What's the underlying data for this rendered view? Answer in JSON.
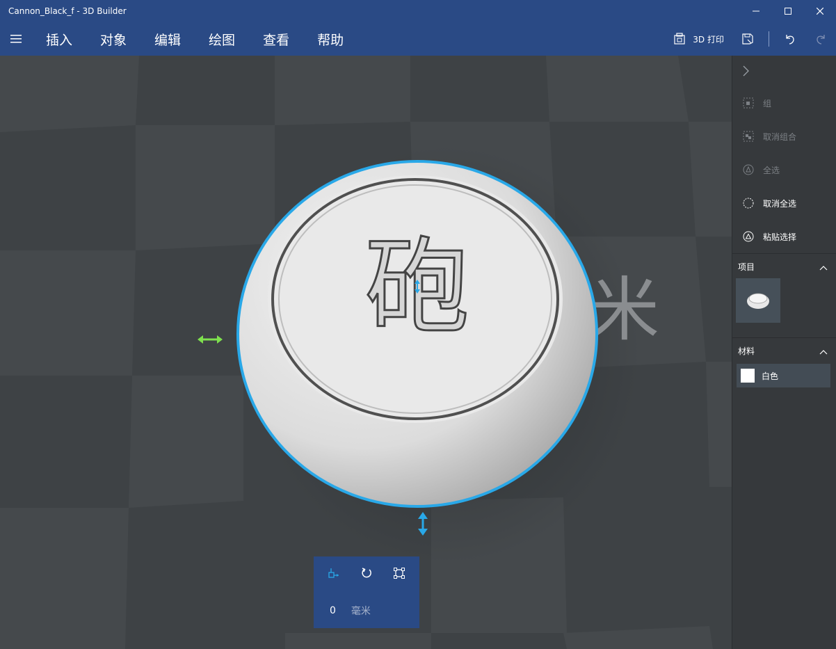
{
  "window": {
    "title": "Cannon_Black_f - 3D Builder"
  },
  "menu": {
    "items": [
      "插入",
      "对象",
      "编辑",
      "绘图",
      "查看",
      "帮助"
    ],
    "print_label": "3D 打印"
  },
  "panel": {
    "actions": [
      {
        "label": "组",
        "enabled": false,
        "icon": "group-icon"
      },
      {
        "label": "取消组合",
        "enabled": false,
        "icon": "ungroup-icon"
      },
      {
        "label": "全选",
        "enabled": false,
        "icon": "select-all-icon"
      },
      {
        "label": "取消全选",
        "enabled": true,
        "icon": "deselect-all-icon"
      },
      {
        "label": "粘贴选择",
        "enabled": true,
        "icon": "paste-selection-icon"
      }
    ],
    "items_header": "项目",
    "materials_header": "材料",
    "material_name": "白色"
  },
  "scene": {
    "character": "砲",
    "unit_watermark": "米"
  },
  "toolbar": {
    "value": "0",
    "unit": "毫米"
  },
  "colors": {
    "titlebar": "#2a4a85",
    "selection": "#29a8e8",
    "x_arrow": "#7ee04e"
  }
}
